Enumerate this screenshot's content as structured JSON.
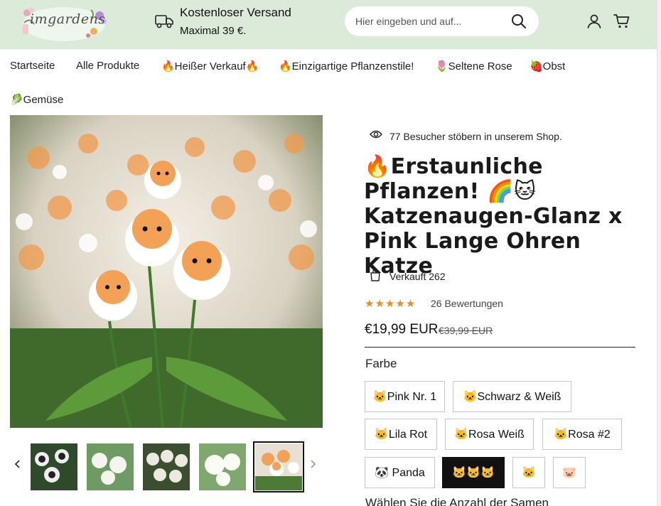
{
  "header": {
    "logo_text": "imgardens",
    "shipping_title": "Kostenloser Versand",
    "shipping_subtitle": "Maximal 39 €.",
    "search_placeholder": "Hier eingeben und auf..."
  },
  "nav": {
    "items": [
      {
        "label": "Startseite"
      },
      {
        "label": "Alle Produkte"
      },
      {
        "label": "🔥Heißer Verkauf🔥"
      },
      {
        "label": "🔥Einzigartige Pflanzenstile!"
      },
      {
        "label": "🌷Seltene Rose"
      },
      {
        "label": "🍓Obst"
      },
      {
        "label": "🥬Gemüse"
      }
    ]
  },
  "gallery": {
    "thumbnail_count": 5,
    "active_thumbnail": 5
  },
  "product": {
    "visitors_text": "77 Besucher stöbern in unserem Shop.",
    "title": "🔥Erstaunliche Pflanzen! 🌈🐱 Katzenaugen-Glanz x Pink Lange Ohren Katze",
    "sold_text": "Verkauft 262",
    "rating": 5,
    "reviews_text": "26 Bewertungen",
    "price": "€19,99 EUR",
    "compare_price": "€39,99 EUR",
    "color_label": "Farbe",
    "color_options": [
      {
        "label": "🐱Pink Nr. 1",
        "selected": false
      },
      {
        "label": "🐱Schwarz & Weiß",
        "selected": false
      },
      {
        "label": "🐱Lila Rot",
        "selected": false
      },
      {
        "label": "🐱Rosa Weiß",
        "selected": false
      },
      {
        "label": "🐱Rosa #2",
        "selected": false
      },
      {
        "label": "🐼 Panda",
        "selected": false
      },
      {
        "label": "🐱🐱🐱",
        "selected": true
      },
      {
        "label": "🐱",
        "selected": false
      },
      {
        "label": "🐷",
        "selected": false
      }
    ],
    "amount_label": "Wählen Sie die Anzahl der Samen"
  },
  "colors": {
    "header_bg": "#dcebd9",
    "star": "#f08a1e",
    "selected_option_bg": "#111111"
  }
}
